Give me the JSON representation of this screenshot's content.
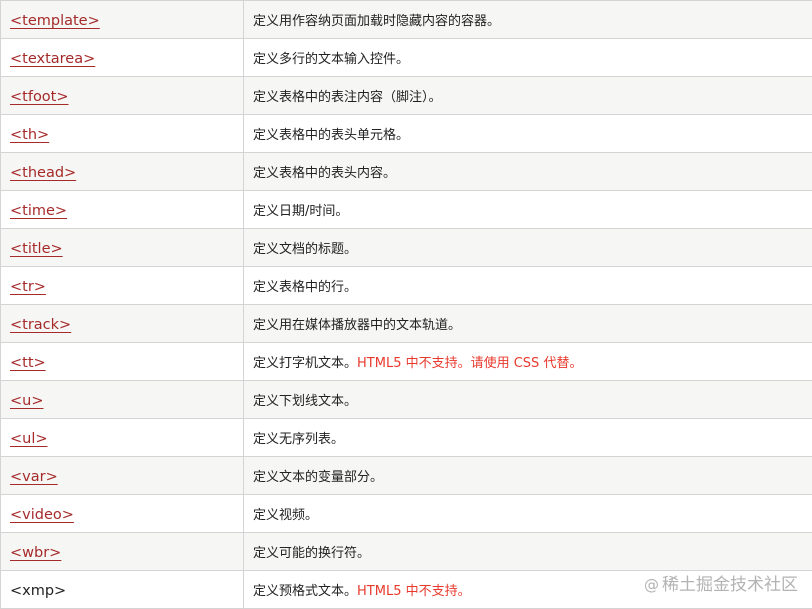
{
  "rows": [
    {
      "tag": "<template>",
      "desc": "定义用作容纳页面加载时隐藏内容的容器。",
      "note": ""
    },
    {
      "tag": "<textarea>",
      "desc": "定义多行的文本输入控件。",
      "note": ""
    },
    {
      "tag": "<tfoot>",
      "desc": "定义表格中的表注内容（脚注）。",
      "note": ""
    },
    {
      "tag": "<th>",
      "desc": "定义表格中的表头单元格。",
      "note": ""
    },
    {
      "tag": "<thead>",
      "desc": "定义表格中的表头内容。",
      "note": ""
    },
    {
      "tag": "<time>",
      "desc": "定义日期/时间。",
      "note": ""
    },
    {
      "tag": "<title>",
      "desc": "定义文档的标题。",
      "note": ""
    },
    {
      "tag": "<tr>",
      "desc": "定义表格中的行。",
      "note": ""
    },
    {
      "tag": "<track>",
      "desc": "定义用在媒体播放器中的文本轨道。",
      "note": ""
    },
    {
      "tag": "<tt>",
      "desc": "定义打字机文本。",
      "note": "HTML5 中不支持。请使用 CSS 代替。"
    },
    {
      "tag": "<u>",
      "desc": "定义下划线文本。",
      "note": ""
    },
    {
      "tag": "<ul>",
      "desc": "定义无序列表。",
      "note": ""
    },
    {
      "tag": "<var>",
      "desc": "定义文本的变量部分。",
      "note": ""
    },
    {
      "tag": "<video>",
      "desc": "定义视频。",
      "note": ""
    },
    {
      "tag": "<wbr>",
      "desc": "定义可能的换行符。",
      "note": ""
    },
    {
      "tag": "<xmp>",
      "desc": "定义预格式文本。",
      "note": "HTML5 中不支持。"
    }
  ],
  "watermark": {
    "at": "@",
    "text": "稀土掘金技术社区"
  },
  "colors": {
    "link": "#a52a2a",
    "warning": "#e8392d",
    "row_alt": "#f6f6f4",
    "border": "#d4d4d4"
  }
}
